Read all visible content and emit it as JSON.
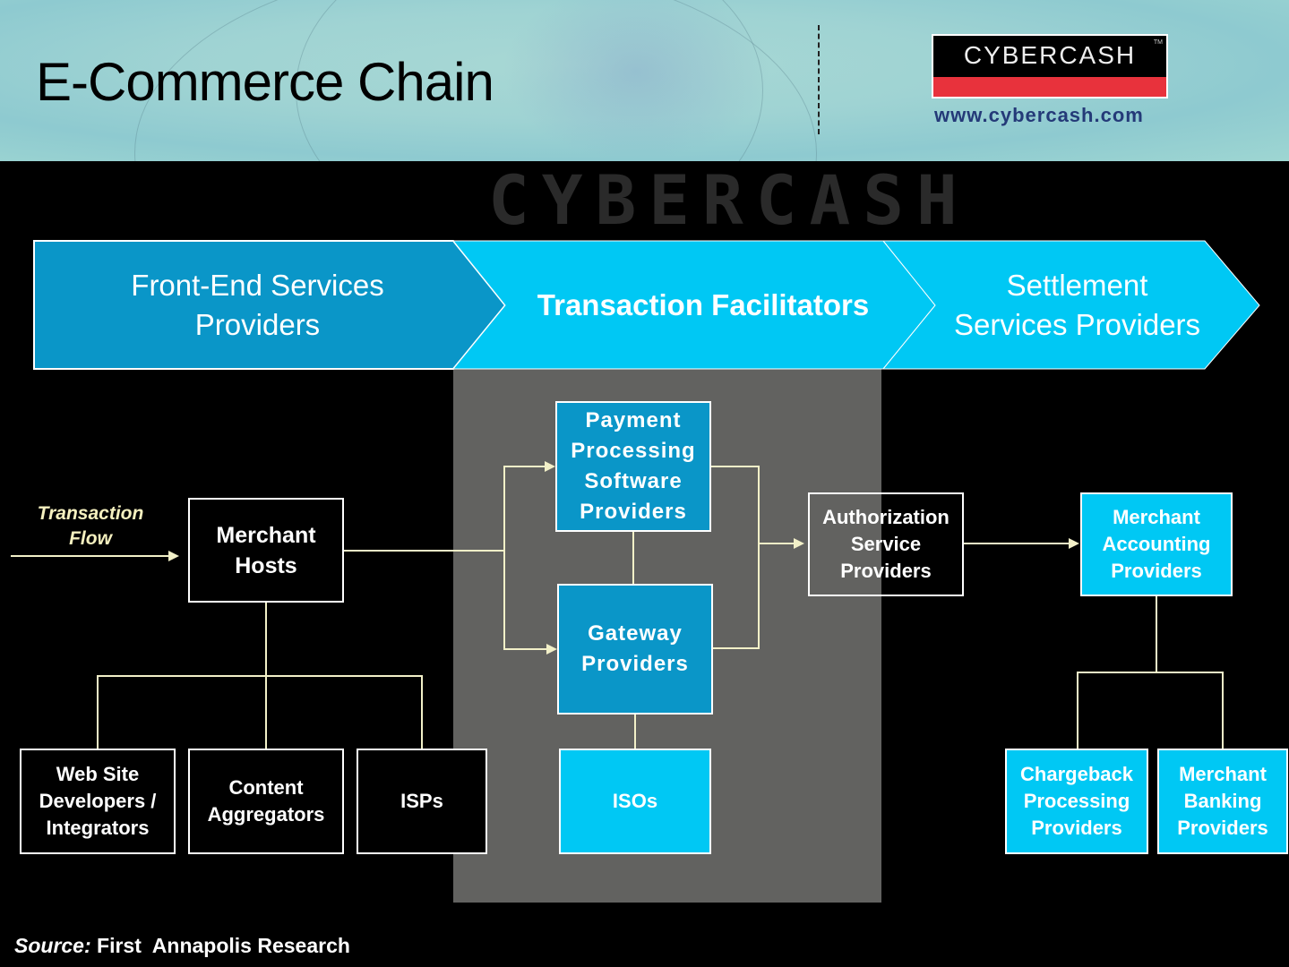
{
  "header": {
    "title": "E-Commerce Chain",
    "logo_text": "CYBERCASH",
    "logo_tm": "TM",
    "url": "www.cybercash.com",
    "watermark": "CYBERCASH"
  },
  "colors": {
    "band_dark": "#0a96c8",
    "band_light": "#00c8f4",
    "connector": "#f2f0c8",
    "gray_band": "#626260",
    "logo_red": "#e8323c"
  },
  "stages": [
    {
      "label": "Front-End Services\nProviders"
    },
    {
      "label": "Transaction Facilitators"
    },
    {
      "label": "Settlement\nServices Providers"
    }
  ],
  "flow_label": "Transaction\nFlow",
  "nodes": {
    "merchant_hosts": "Merchant\nHosts",
    "web_site_developers": "Web Site\nDevelopers /\nIntegrators",
    "content_aggregators": "Content\nAggregators",
    "isps": "ISPs",
    "payment_processing": "Payment\nProcessing\nSoftware\nProviders",
    "gateway_providers": "Gateway\nProviders",
    "isos": "ISOs",
    "authorization": "Authorization\nService\nProviders",
    "merchant_accounting": "Merchant\nAccounting\nProviders",
    "chargeback": "Chargeback\nProcessing\nProviders",
    "merchant_banking": "Merchant\nBanking\nProviders"
  },
  "footer": {
    "source_label": "Source:",
    "source_text": "First  Annapolis Research"
  }
}
